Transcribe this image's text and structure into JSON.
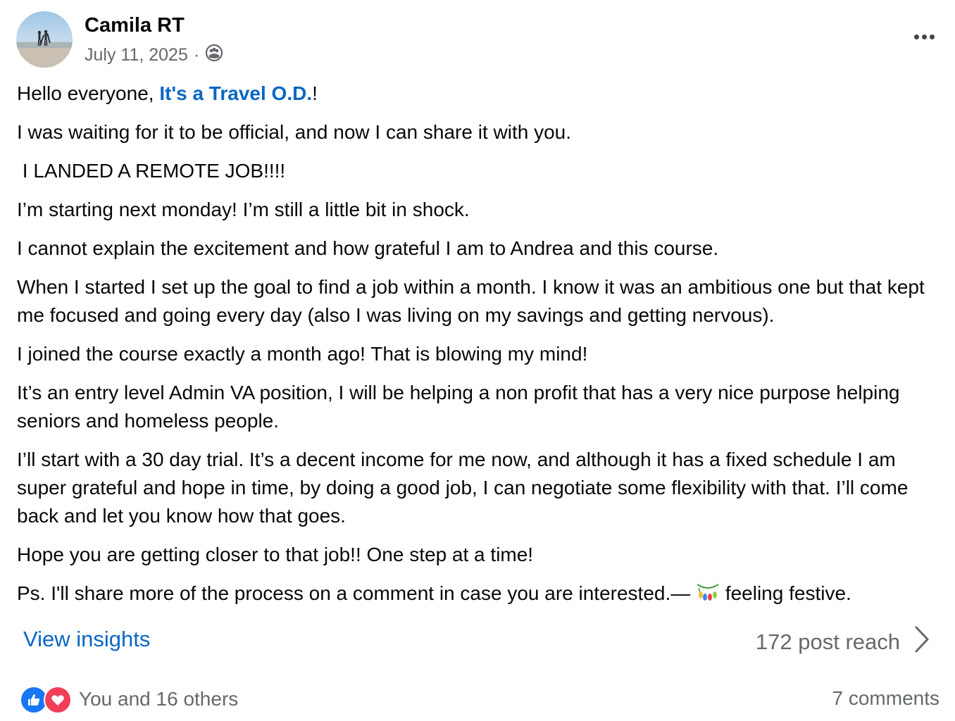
{
  "header": {
    "author": "Camila RT",
    "date": "July 11, 2025",
    "separator": "·",
    "audience_icon": "group-icon"
  },
  "post": {
    "greeting_prefix": "Hello everyone, ",
    "group_link": "It's a Travel O.D.",
    "greeting_suffix": "!",
    "paragraphs": [
      "I was waiting for it to be official, and now I can share it with you.",
      " I LANDED A REMOTE JOB!!!!",
      "I’m starting next monday! I’m still a little bit in shock.",
      "I cannot explain the excitement and how grateful I am to Andrea and this course.",
      "When I started I set up the goal to find a job within a month. I know it was an ambitious one but that kept me focused and going every day (also I was living on my savings and getting nervous).",
      "I joined the course exactly a month ago! That is blowing my mind!",
      "It’s an entry level Admin VA position, I will be helping a non profit that has a very nice purpose helping seniors and homeless people.",
      "I’ll start with a 30 day trial. It’s a decent income for me now, and although it has a fixed schedule I am super grateful and hope in time, by doing a good job, I can negotiate some flexibility with that. I’ll come back and let you know how that goes.",
      "Hope you are getting closer to that job!! One step at a time!"
    ],
    "closing_text": "Ps. I'll share more of the process on a comment in case you are interested.—",
    "feeling_icon": "string-lights-icon",
    "feeling_text": "feeling festive."
  },
  "footer": {
    "insights_label": "View insights",
    "reach_label": "172 post reach",
    "reactions_text": "You and 16 others",
    "comments_label": "7 comments"
  },
  "colors": {
    "link": "#0a66c2",
    "muted": "#65686c",
    "like": "#1877f2",
    "love": "#f33e58"
  }
}
